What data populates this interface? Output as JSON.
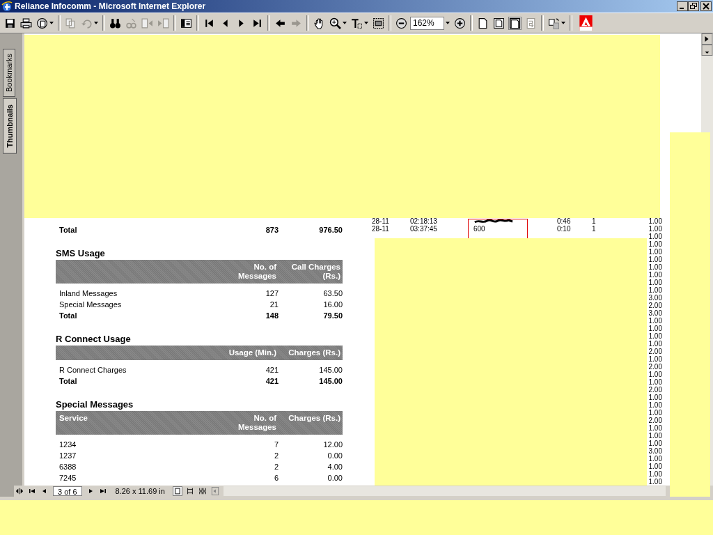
{
  "window": {
    "title": "Reliance Infocomm - Microsoft Internet Explorer"
  },
  "toolbar": {
    "zoom": "162%"
  },
  "side_tabs": [
    {
      "label": "Bookmarks",
      "selected": false
    },
    {
      "label": "Thumbnails",
      "selected": true
    }
  ],
  "document": {
    "top_total": {
      "label": "Total",
      "count": "873",
      "amount": "976.50"
    },
    "sections": [
      {
        "title": "SMS Usage",
        "columns": [
          "",
          "No. of\nMessages",
          "Call Charges\n(Rs.)"
        ],
        "rows": [
          {
            "cells": [
              "Inland Messages",
              "127",
              "63.50"
            ],
            "total": false
          },
          {
            "cells": [
              "Special Messages",
              "21",
              "16.00"
            ],
            "total": false
          },
          {
            "cells": [
              "Total",
              "148",
              "79.50"
            ],
            "total": true
          }
        ]
      },
      {
        "title": "R Connect Usage",
        "columns": [
          "",
          "Usage (Min.)",
          "Charges (Rs.)"
        ],
        "rows": [
          {
            "cells": [
              "R Connect Charges",
              "421",
              "145.00"
            ],
            "total": false
          },
          {
            "cells": [
              "Total",
              "421",
              "145.00"
            ],
            "total": true
          }
        ]
      },
      {
        "title": "Special Messages",
        "columns": [
          "Service",
          "No. of\nMessages",
          "Charges (Rs.)"
        ],
        "rows": [
          {
            "cells": [
              "1234",
              "7",
              "12.00"
            ],
            "total": false
          },
          {
            "cells": [
              "1237",
              "2",
              "0.00"
            ],
            "total": false
          },
          {
            "cells": [
              "6388",
              "2",
              "4.00"
            ],
            "total": false
          },
          {
            "cells": [
              "7245",
              "6",
              "0.00"
            ],
            "total": false
          }
        ]
      }
    ],
    "calls": [
      {
        "kind": "full",
        "date": "28-11",
        "time": "02:18:13",
        "number_scribbled": true,
        "duration": "0:46",
        "count": "1",
        "amount": "1.00"
      },
      {
        "kind": "full",
        "date": "28-11",
        "time": "03:37:45",
        "number": "600",
        "number_scribbled": false,
        "duration": "0:10",
        "count": "1",
        "amount": "1.00"
      },
      {
        "kind": "amount",
        "amount": "1.00"
      },
      {
        "kind": "amount",
        "amount": "1.00"
      },
      {
        "kind": "amount",
        "amount": "1.00"
      },
      {
        "kind": "amount",
        "amount": "1.00"
      },
      {
        "kind": "amount",
        "amount": "1.00"
      },
      {
        "kind": "amount",
        "amount": "1.00"
      },
      {
        "kind": "amount",
        "amount": "1.00"
      },
      {
        "kind": "amount",
        "amount": "1.00"
      },
      {
        "kind": "amount",
        "amount": "3.00"
      },
      {
        "kind": "amount",
        "amount": "2.00"
      },
      {
        "kind": "amount",
        "amount": "3.00"
      },
      {
        "kind": "amount",
        "amount": "1.00"
      },
      {
        "kind": "amount",
        "amount": "1.00"
      },
      {
        "kind": "amount",
        "amount": "1.00"
      },
      {
        "kind": "amount",
        "amount": "1.00"
      },
      {
        "kind": "amount",
        "amount": "2.00"
      },
      {
        "kind": "amount",
        "amount": "1.00"
      },
      {
        "kind": "amount",
        "amount": "2.00"
      },
      {
        "kind": "amount",
        "amount": "1.00"
      },
      {
        "kind": "amount",
        "amount": "1.00"
      },
      {
        "kind": "amount",
        "amount": "2.00"
      },
      {
        "kind": "amount",
        "amount": "1.00"
      },
      {
        "kind": "amount",
        "amount": "1.00"
      },
      {
        "kind": "amount",
        "amount": "1.00"
      },
      {
        "kind": "amount",
        "amount": "2.00"
      },
      {
        "kind": "amount",
        "amount": "1.00"
      },
      {
        "kind": "amount",
        "amount": "1.00"
      },
      {
        "kind": "amount",
        "amount": "1.00"
      },
      {
        "kind": "amount",
        "amount": "3.00"
      },
      {
        "kind": "amount",
        "amount": "1.00"
      },
      {
        "kind": "amount",
        "amount": "1.00"
      },
      {
        "kind": "amount",
        "amount": "1.00"
      },
      {
        "kind": "amount",
        "amount": "1.00"
      }
    ]
  },
  "status_bar": {
    "page": "3 of 6",
    "page_size": "8.26 x 11.69 in"
  }
}
